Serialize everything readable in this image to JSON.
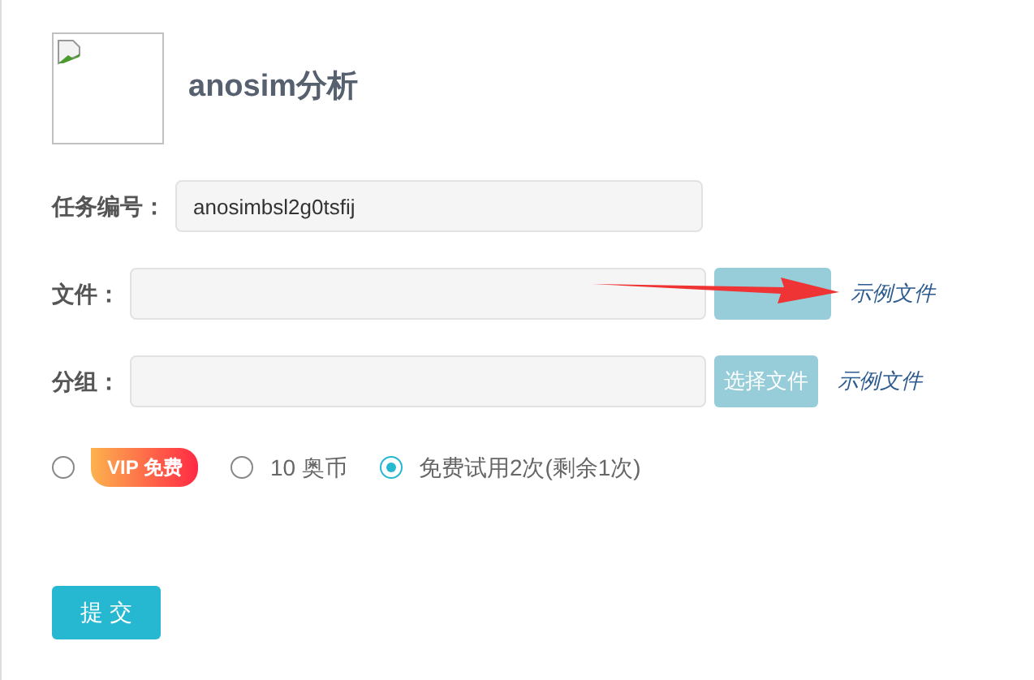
{
  "title": "anosim分析",
  "fields": [
    {
      "kind": "text",
      "label": "任务编号：",
      "value": "anosimbsl2g0tsfij"
    },
    {
      "kind": "file",
      "label": "文件：",
      "link": "示例文件"
    },
    {
      "kind": "file",
      "label": "分组：",
      "button": "选择文件",
      "link": "示例文件"
    }
  ],
  "pricing": [
    {
      "kind": "badge",
      "label": "VIP 免费",
      "selected": false
    },
    {
      "kind": "text",
      "label": "10 奥币",
      "selected": false
    },
    {
      "kind": "text",
      "label": "免费试用2次(剩余1次)",
      "selected": true
    }
  ],
  "submit": "提 交"
}
